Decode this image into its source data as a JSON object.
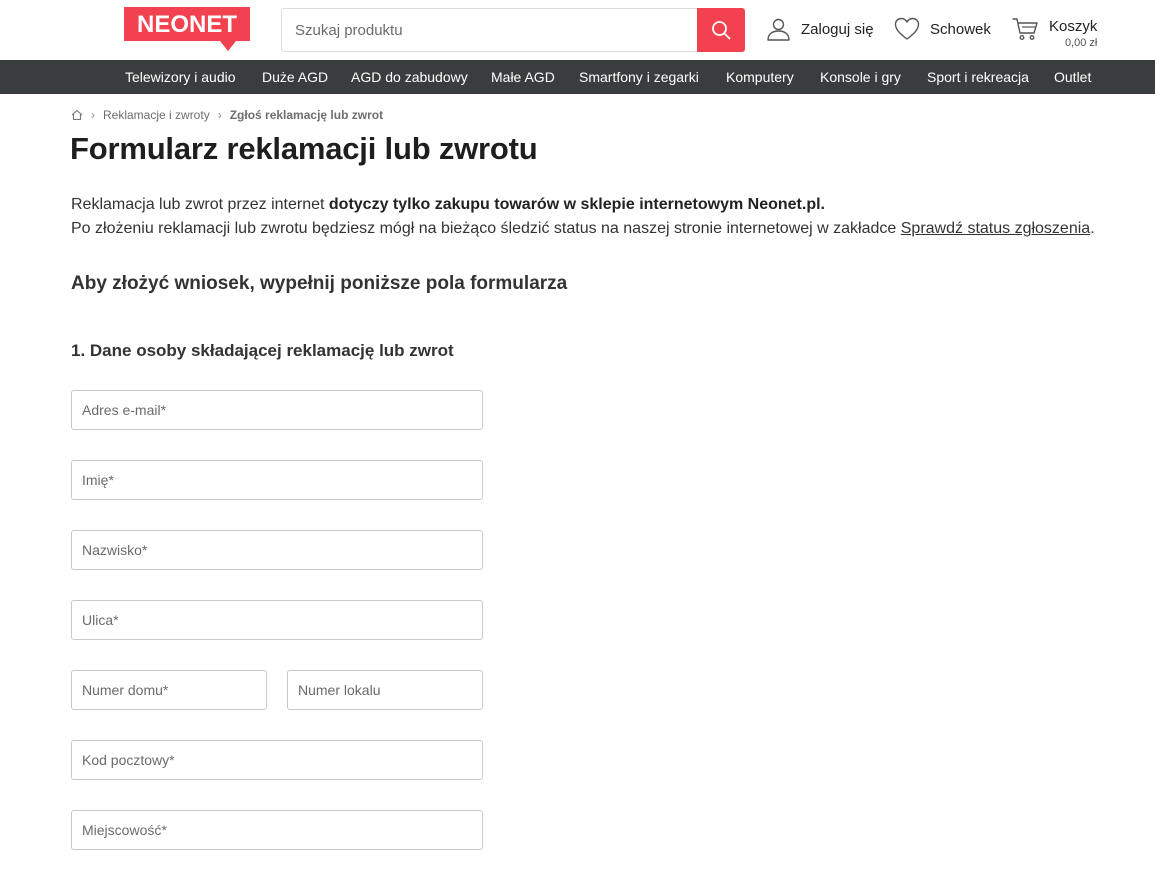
{
  "header": {
    "logo_text": "NEONET",
    "search_placeholder": "Szukaj produktu",
    "login_label": "Zaloguj się",
    "wishlist_label": "Schowek",
    "cart_label": "Koszyk",
    "cart_price": "0,00 zł",
    "brand_color": "#f3424f"
  },
  "nav": {
    "items": [
      "Telewizory i audio",
      "Duże AGD",
      "AGD do zabudowy",
      "Małe AGD",
      "Smartfony i zegarki",
      "Komputery",
      "Konsole i gry",
      "Sport i rekreacja",
      "Outlet"
    ]
  },
  "breadcrumb": {
    "items": [
      "Reklamacje i zwroty",
      "Zgłoś reklamację lub zwrot"
    ]
  },
  "page": {
    "title": "Formularz reklamacji lub zwrotu",
    "intro_line1_regular": "Reklamacja lub zwrot przez internet ",
    "intro_line1_bold": "dotyczy tylko zakupu towarów w sklepie internetowym Neonet.pl.",
    "intro_line2_text": "Po złożeniu reklamacji lub zwrotu będziesz mógł na bieżąco śledzić status na naszej stronie internetowej w zakładce ",
    "intro_line2_link": "Sprawdź status zgłoszenia",
    "intro_line2_end": ".",
    "subtitle": "Aby złożyć wniosek, wypełnij poniższe pola formularza",
    "section1_title": "1. Dane osoby składającej reklamację lub zwrot"
  },
  "form": {
    "email_placeholder": "Adres e-mail*",
    "first_name_placeholder": "Imię*",
    "last_name_placeholder": "Nazwisko*",
    "street_placeholder": "Ulica*",
    "house_number_placeholder": "Numer domu*",
    "apartment_number_placeholder": "Numer lokalu",
    "postal_code_placeholder": "Kod pocztowy*",
    "city_placeholder": "Miejscowość*",
    "email_value": "",
    "first_name_value": "",
    "last_name_value": "",
    "street_value": "",
    "house_number_value": "",
    "apartment_number_value": "",
    "postal_code_value": "",
    "city_value": ""
  },
  "icons": {
    "home": "home-icon",
    "search": "search-icon",
    "user": "user-icon",
    "heart": "heart-icon",
    "cart": "cart-icon"
  }
}
